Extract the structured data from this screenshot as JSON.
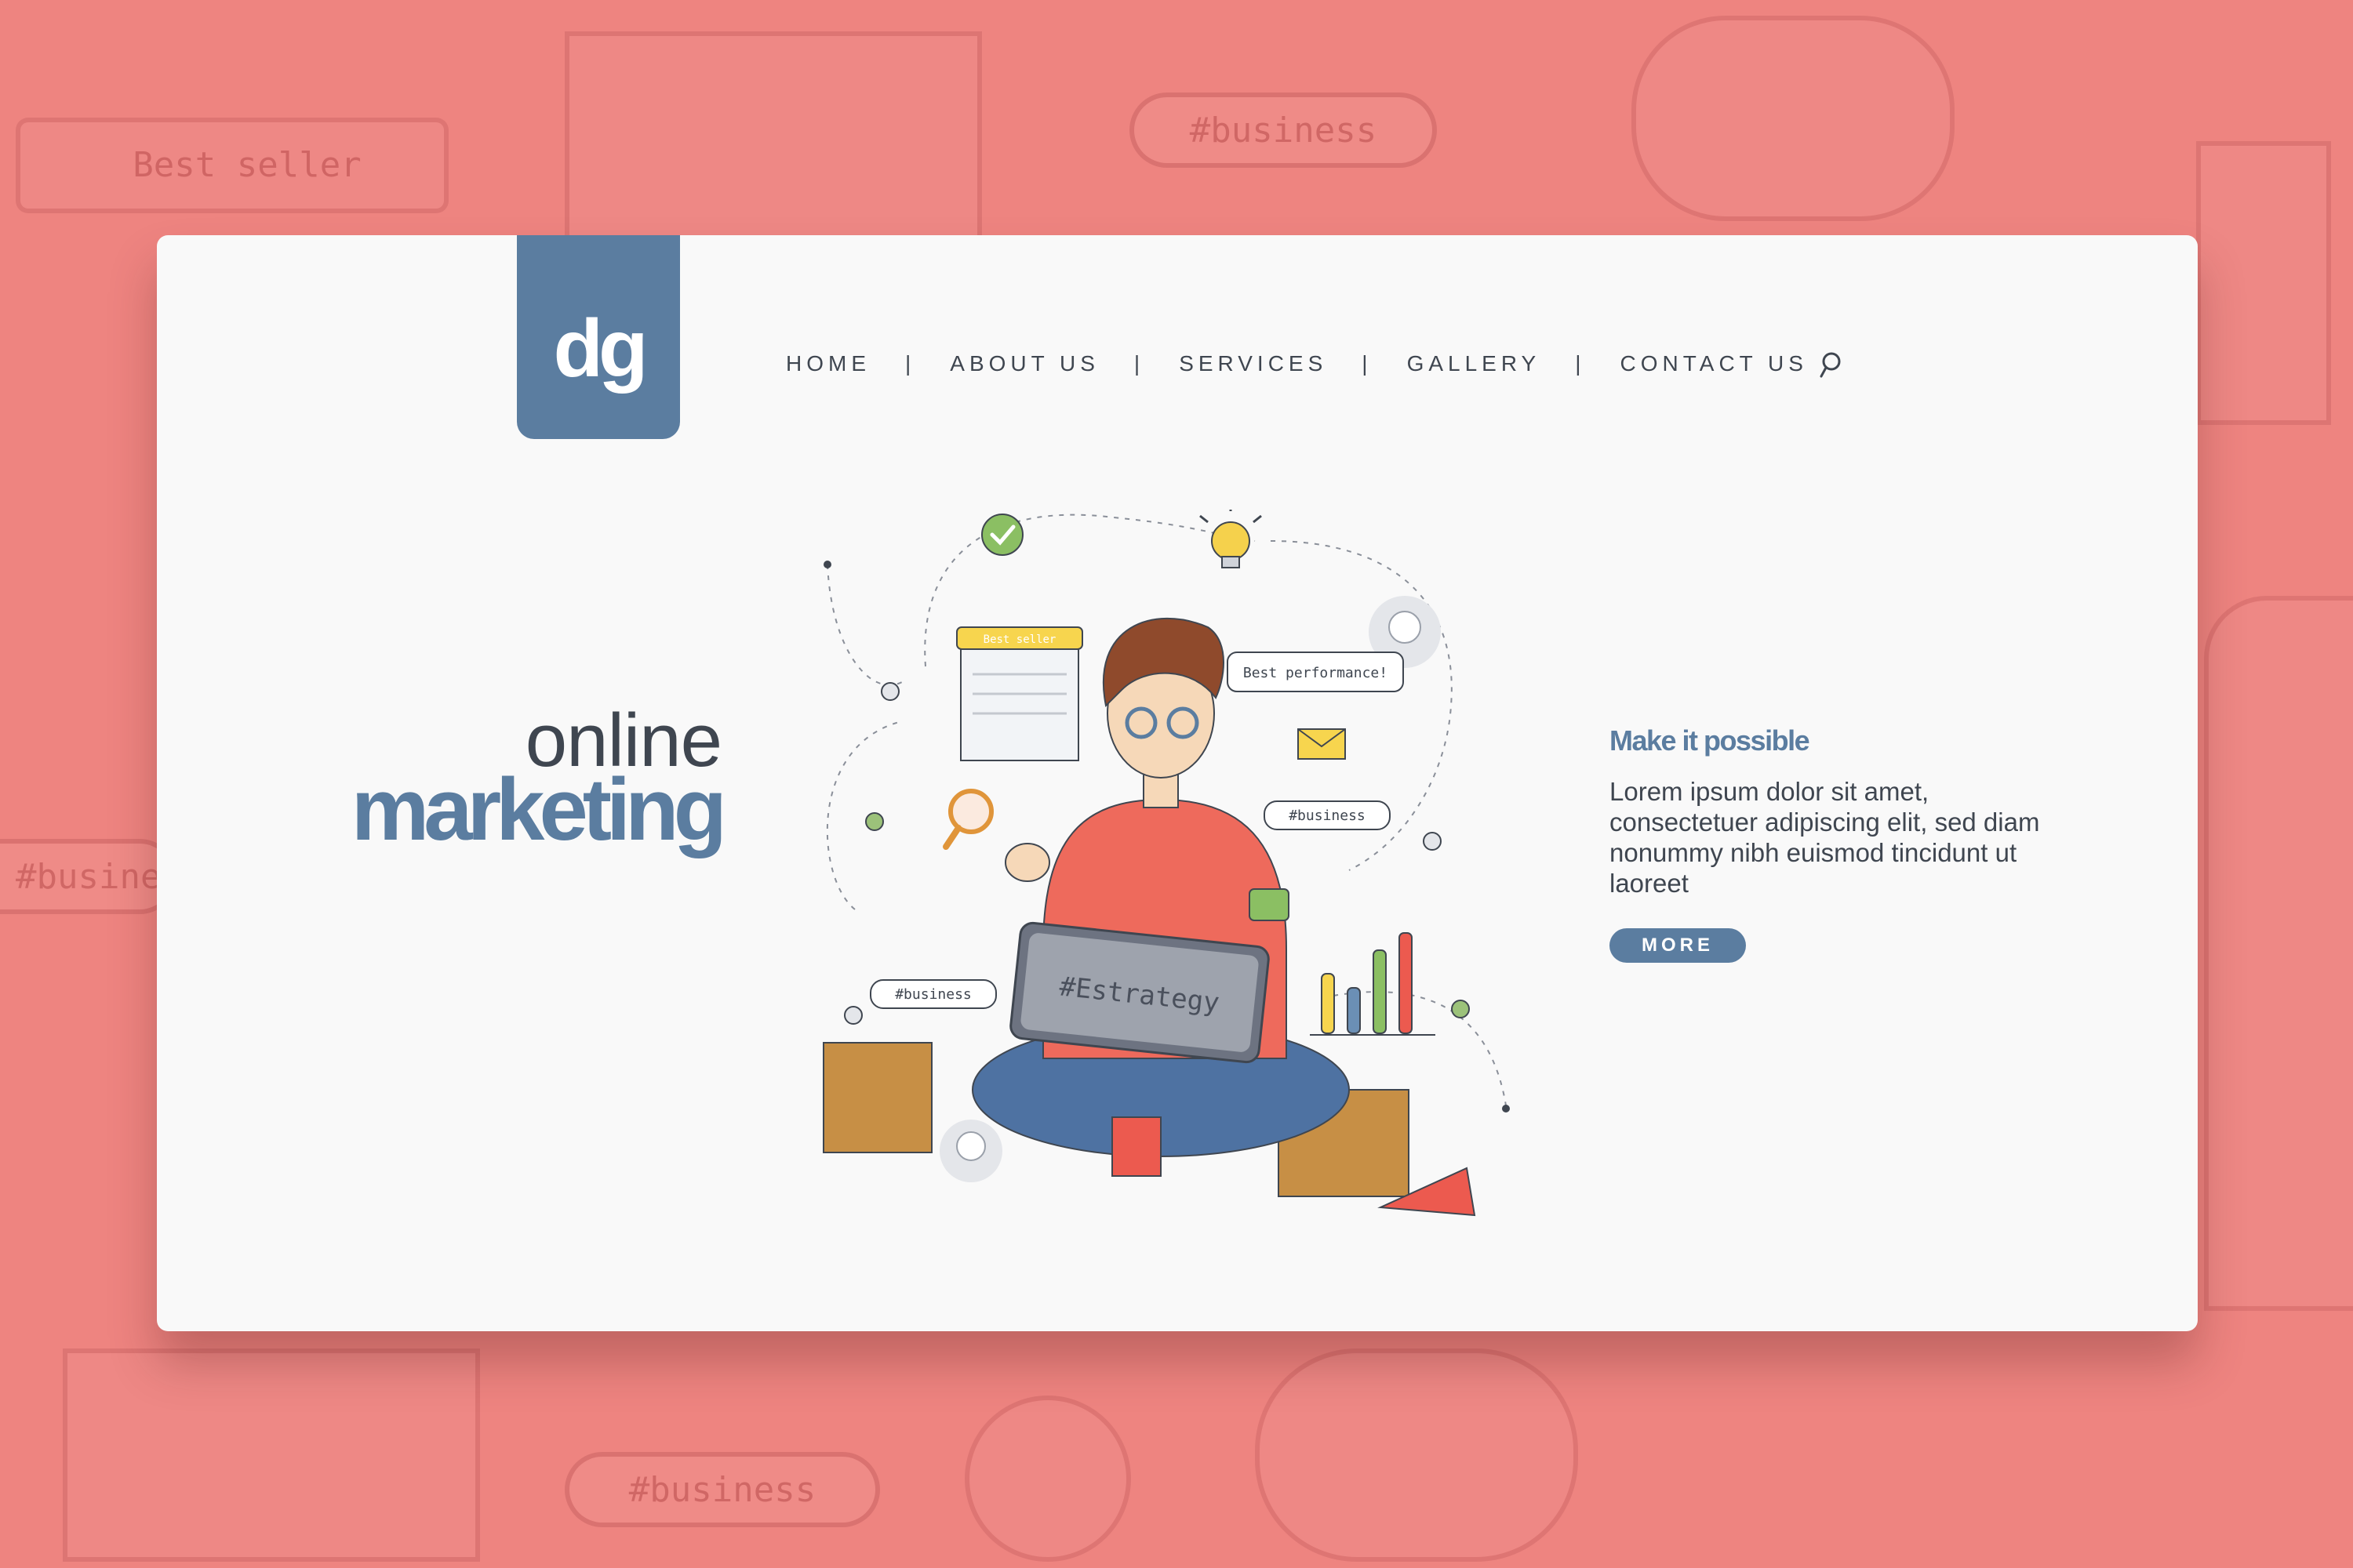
{
  "logo": {
    "text": "dg"
  },
  "nav": {
    "items": [
      "HOME",
      "ABOUT US",
      "SERVICES",
      "GALLERY",
      "CONTACT US"
    ],
    "separator": "|",
    "search_icon": "search-icon"
  },
  "hero": {
    "title_light": "online",
    "title_bold": "marketing"
  },
  "aside": {
    "heading": "Make it possible",
    "body": "Lorem ipsum dolor sit amet, consectetuer adipiscing elit, sed diam nonummy nibh euismod tincidunt ut laoreet",
    "button": "MORE"
  },
  "illustration": {
    "best_seller": "Best seller",
    "speech": "Best performance!",
    "tag_1": "#business",
    "tag_2": "#business",
    "laptop": "#Estrategy"
  },
  "background": {
    "pill_1": "#business",
    "pill_2": "#business",
    "pill_3": "#busine",
    "sign": "Best seller"
  },
  "colors": {
    "page_bg": "#ee8480",
    "card_bg": "#f9f9f9",
    "accent": "#5b7da0",
    "text": "#3f4650"
  }
}
